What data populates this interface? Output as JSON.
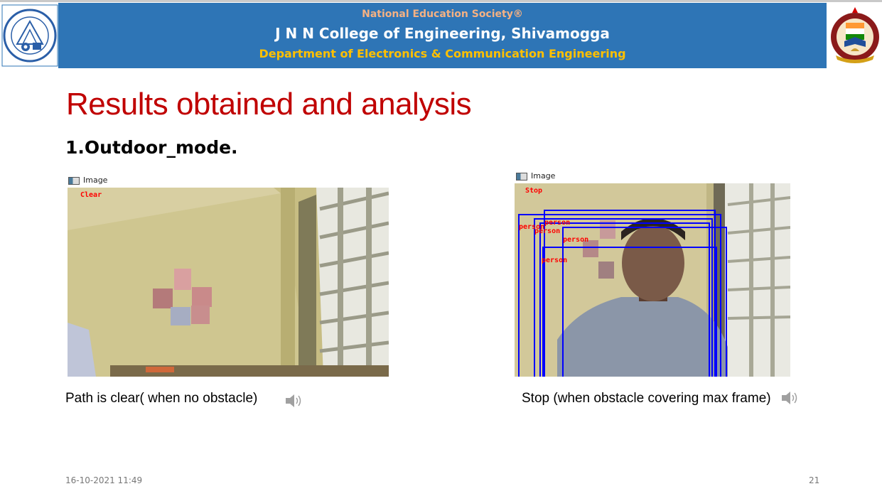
{
  "header": {
    "org": "National Education Society®",
    "college": "J N N College of Engineering, Shivamogga",
    "department": "Department of Electronics & Communication Engineering"
  },
  "slide": {
    "title": "Results obtained and analysis",
    "subtitle": "1.Outdoor_mode."
  },
  "figures": [
    {
      "window_title": "Image",
      "overlay_label": "Clear",
      "caption": "Path is clear( when no obstacle)"
    },
    {
      "window_title": "Image",
      "overlay_label": "Stop",
      "detections": [
        "person",
        "person",
        "person",
        "person",
        "person"
      ],
      "caption": "Stop (when obstacle covering max frame)"
    }
  ],
  "footer": {
    "date": "16-10-2021 11:49",
    "page_number": "21"
  },
  "colors": {
    "banner": "#2e75b6",
    "title": "#c00000",
    "org_text": "#f4b183",
    "dept_text": "#ffc000",
    "bbox": "#0000ff",
    "label": "#ff0000"
  }
}
